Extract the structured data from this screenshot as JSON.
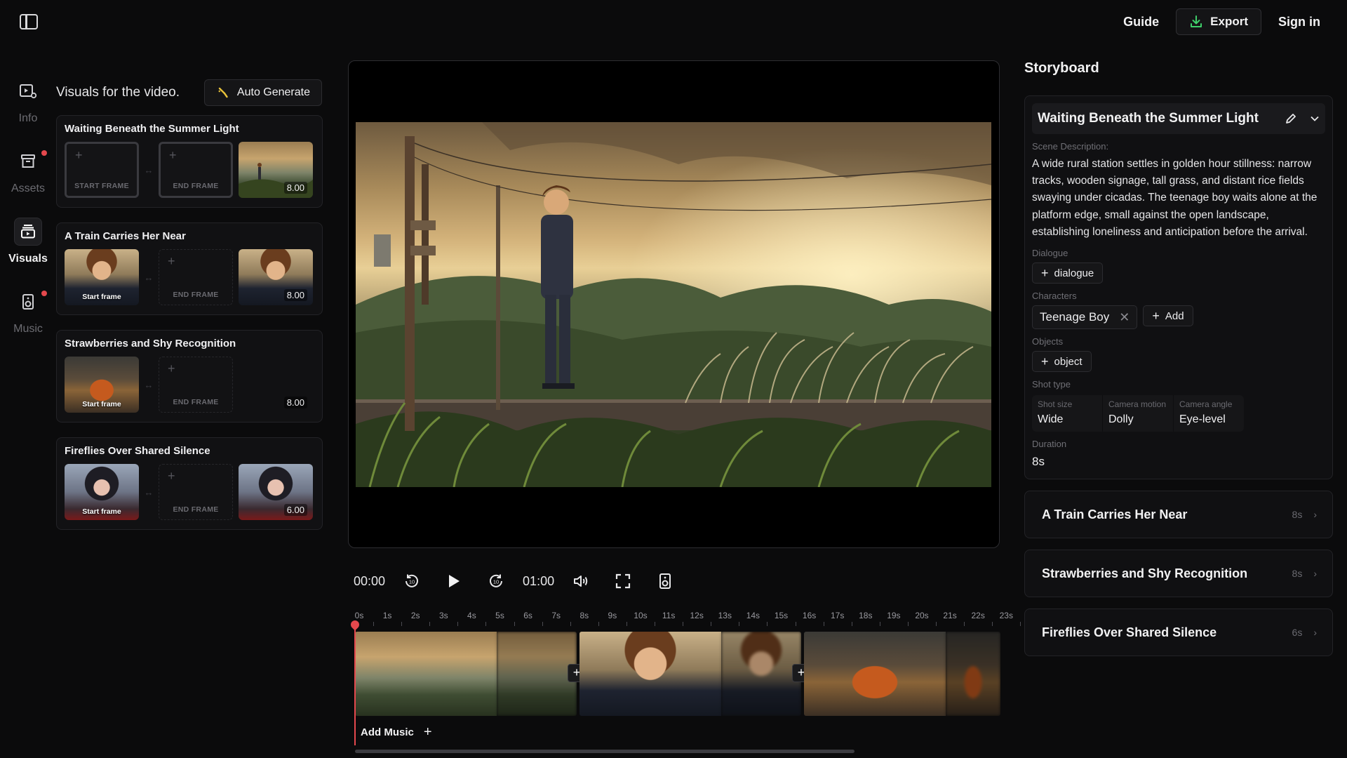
{
  "header": {
    "guide": "Guide",
    "export": "Export",
    "sign_in": "Sign in"
  },
  "nav": [
    {
      "label": "Info",
      "icon": "video-settings-icon"
    },
    {
      "label": "Assets",
      "icon": "archive-icon"
    },
    {
      "label": "Visuals",
      "icon": "layers-icon"
    },
    {
      "label": "Music",
      "icon": "speaker-icon"
    }
  ],
  "visuals": {
    "title": "Visuals for the video.",
    "auto_generate": "Auto Generate",
    "scenes": [
      {
        "name": "Waiting Beneath the Summer Light",
        "start_label": "START FRAME",
        "end_label": "END FRAME",
        "duration": "8.00"
      },
      {
        "name": "A Train Carries Her Near",
        "start_label": "Start frame",
        "end_label": "END FRAME",
        "duration": "8.00"
      },
      {
        "name": "Strawberries and Shy Recognition",
        "start_label": "Start frame",
        "end_label": "END FRAME",
        "duration": "8.00"
      },
      {
        "name": "Fireflies Over Shared Silence",
        "start_label": "Start frame",
        "end_label": "END FRAME",
        "duration": "6.00"
      }
    ]
  },
  "player": {
    "current_time": "00:00",
    "total_time": "01:00"
  },
  "timeline": {
    "ticks": [
      "0s",
      "1s",
      "2s",
      "3s",
      "4s",
      "5s",
      "6s",
      "7s",
      "8s",
      "9s",
      "10s",
      "11s",
      "12s",
      "13s",
      "14s",
      "15s",
      "16s",
      "17s",
      "18s",
      "19s",
      "20s",
      "21s",
      "22s",
      "23s"
    ],
    "add_music": "Add Music"
  },
  "storyboard": {
    "title": "Storyboard",
    "active": {
      "title": "Waiting Beneath the Summer Light",
      "scene_description_label": "Scene Description:",
      "scene_description": "A wide rural station settles in golden hour stillness: narrow tracks, wooden signage, tall grass, and distant rice fields swaying under cicadas. The teenage boy waits alone at the platform edge, small against the open landscape, establishing loneliness and anticipation before the arrival.",
      "dialogue_label": "Dialogue",
      "dialogue_button": "dialogue",
      "characters_label": "Characters",
      "characters": [
        "Teenage Boy"
      ],
      "add_character": "Add",
      "objects_label": "Objects",
      "object_button": "object",
      "shot_type_label": "Shot type",
      "shot": [
        {
          "key": "Shot size",
          "value": "Wide"
        },
        {
          "key": "Camera motion",
          "value": "Dolly"
        },
        {
          "key": "Camera angle",
          "value": "Eye-level"
        }
      ],
      "duration_label": "Duration",
      "duration": "8s"
    },
    "items": [
      {
        "title": "A Train Carries Her Near",
        "duration": "8s"
      },
      {
        "title": "Strawberries and Shy Recognition",
        "duration": "8s"
      },
      {
        "title": "Fireflies Over Shared Silence",
        "duration": "6s"
      }
    ]
  }
}
